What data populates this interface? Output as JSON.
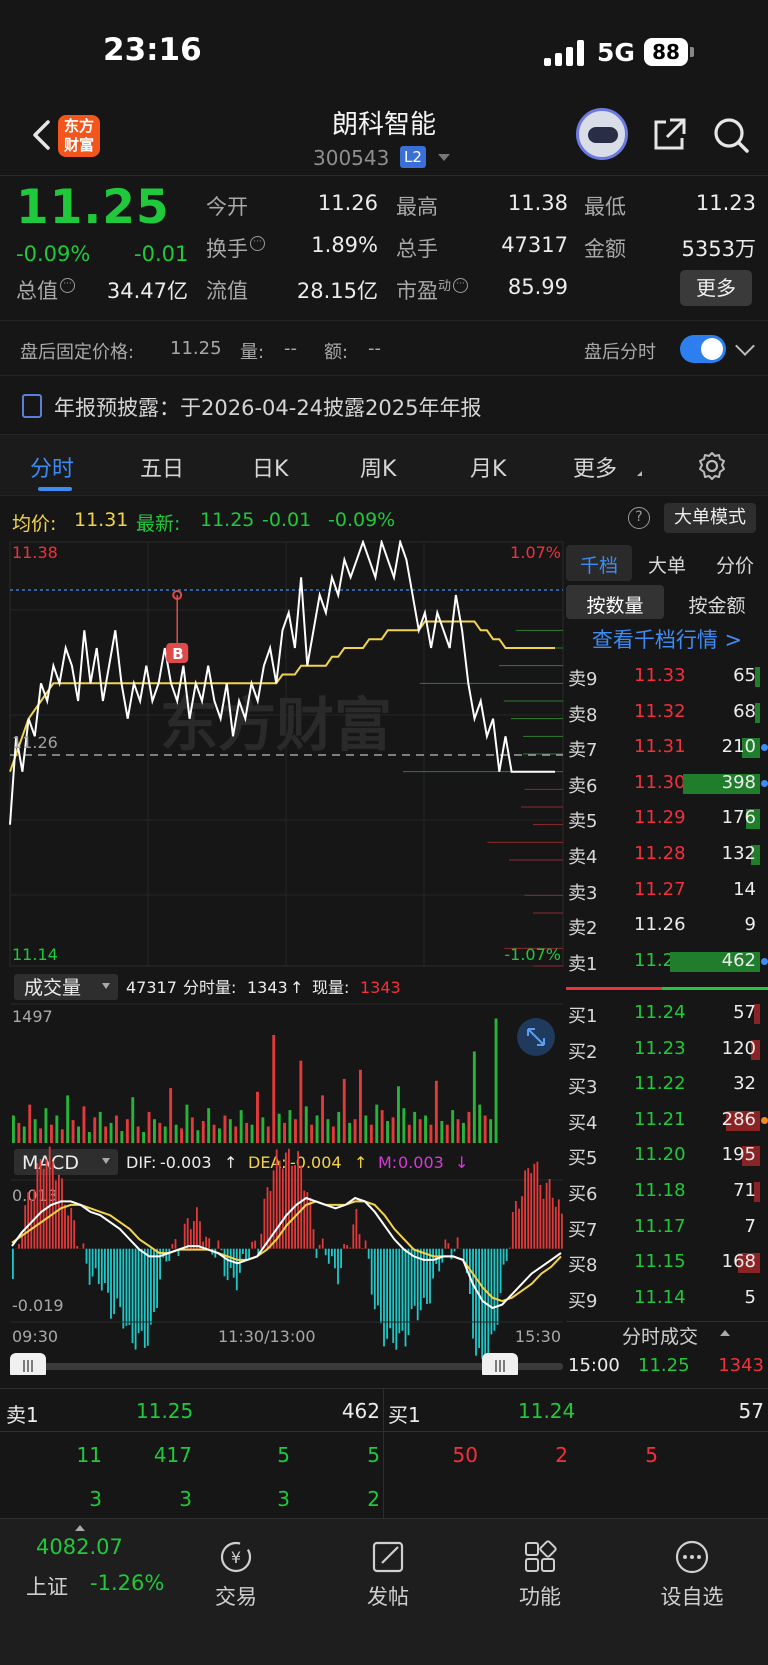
{
  "status_bar": {
    "time": "23:16",
    "network": "5G",
    "battery": "88"
  },
  "header": {
    "logo_text": "东方财富",
    "stock_name": "朗科智能",
    "stock_code": "300543",
    "level_badge": "L2"
  },
  "quote": {
    "price": "11.25",
    "change_pct": "-0.09%",
    "change": "-0.01",
    "open_label": "今开",
    "open": "11.26",
    "high_label": "最高",
    "high": "11.38",
    "low_label": "最低",
    "low": "11.23",
    "turnover_label": "换手",
    "turnover": "1.89%",
    "volume_label": "总手",
    "volume": "47317",
    "amount_label": "金额",
    "amount": "5353万",
    "mktcap_label": "总值",
    "mktcap": "34.47亿",
    "float_label": "流值",
    "float_cap": "28.15亿",
    "pe_label": "市盈",
    "pe_sup": "动",
    "pe": "85.99",
    "more_label": "更多"
  },
  "after_hours": {
    "fixed_price_label": "盘后固定价格:",
    "fixed_price": "11.25",
    "volume_label": "量:",
    "volume": "--",
    "amount_label": "额:",
    "amount": "--",
    "intraday_label": "盘后分时",
    "toggle_on": true
  },
  "notice": {
    "text": "年报预披露：于2026-04-24披露2025年年报"
  },
  "tabs": [
    {
      "label": "分时",
      "active": true
    },
    {
      "label": "五日"
    },
    {
      "label": "日K"
    },
    {
      "label": "周K"
    },
    {
      "label": "月K"
    },
    {
      "label": "更多"
    }
  ],
  "avg_bar": {
    "avg_label": "均价:",
    "avg": "11.31",
    "latest_label": "最新:",
    "latest": "11.25",
    "chg": "-0.01",
    "pct": "-0.09%",
    "big_order_label": "大单模式"
  },
  "chart_data": [
    {
      "type": "line",
      "y_max": "11.38",
      "y_min": "11.14",
      "y_ref": "11.26",
      "pct_max": "1.07%",
      "pct_min": "-1.07%",
      "x_labels": [
        "09:30",
        "11:30/13:00",
        "15:30"
      ],
      "ylim": [
        11.14,
        11.38
      ],
      "series": [
        {
          "values": [
            11.22,
            11.27,
            11.25,
            11.28,
            11.27,
            11.3,
            11.29,
            11.31,
            11.3,
            11.32,
            11.31,
            11.29,
            11.33,
            11.3,
            11.32,
            11.29,
            11.31,
            11.33,
            11.3,
            11.28,
            11.3,
            11.29,
            11.31,
            11.29,
            11.3,
            11.32,
            11.3,
            11.29,
            11.31,
            11.28,
            11.3,
            11.29,
            11.31,
            11.29,
            11.28,
            11.3,
            11.27,
            11.29,
            11.28,
            11.3,
            11.29,
            11.31,
            11.32,
            11.3,
            11.33,
            11.34,
            11.32,
            11.36,
            11.31,
            11.33,
            11.35,
            11.34,
            11.36,
            11.35,
            11.37,
            11.36,
            11.37,
            11.38,
            11.37,
            11.36,
            11.38,
            11.37,
            11.36,
            11.38,
            11.37,
            11.35,
            11.33,
            11.34,
            11.32,
            11.34,
            11.33,
            11.32,
            11.35,
            11.33,
            11.3,
            11.28,
            11.29,
            11.27,
            11.28,
            11.25,
            11.27,
            11.25,
            11.25,
            11.25,
            11.25,
            11.25,
            11.25,
            11.25,
            11.25
          ]
        },
        {
          "values": [
            11.25,
            11.26,
            11.27,
            11.28,
            11.285,
            11.29,
            11.295,
            11.3,
            11.3,
            11.3,
            11.3,
            11.3,
            11.3,
            11.3,
            11.3,
            11.3,
            11.3,
            11.3,
            11.3,
            11.3,
            11.3,
            11.3,
            11.3,
            11.3,
            11.3,
            11.3,
            11.3,
            11.3,
            11.3,
            11.3,
            11.3,
            11.3,
            11.3,
            11.3,
            11.3,
            11.3,
            11.3,
            11.3,
            11.3,
            11.3,
            11.3,
            11.3,
            11.3,
            11.3,
            11.305,
            11.305,
            11.305,
            11.31,
            11.31,
            11.31,
            11.31,
            11.31,
            11.315,
            11.315,
            11.32,
            11.32,
            11.32,
            11.32,
            11.325,
            11.325,
            11.325,
            11.33,
            11.33,
            11.33,
            11.33,
            11.33,
            11.33,
            11.335,
            11.335,
            11.335,
            11.335,
            11.335,
            11.335,
            11.335,
            11.335,
            11.335,
            11.33,
            11.33,
            11.325,
            11.325,
            11.32,
            11.32,
            11.32,
            11.32,
            11.32,
            11.32,
            11.32,
            11.32,
            11.32
          ]
        }
      ],
      "marker": "B"
    },
    {
      "type": "bar",
      "label": "成交量",
      "total": "47317",
      "period_label": "分时量:",
      "period_vol": "1343",
      "now_label": "现量:",
      "now_vol": "1343",
      "y_max": "1497",
      "values": [
        300,
        220,
        180,
        420,
        260,
        160,
        380,
        200,
        300,
        150,
        520,
        250,
        180,
        400,
        120,
        280,
        340,
        180,
        220,
        300,
        130,
        260,
        500,
        180,
        120,
        340,
        260,
        220,
        180,
        600,
        200,
        160,
        420,
        280,
        140,
        240,
        380,
        200,
        160,
        300,
        260,
        180,
        360,
        220,
        200,
        560,
        280,
        180,
        1180,
        320,
        220,
        360,
        260,
        900,
        400,
        200,
        300,
        520,
        260,
        180,
        340,
        700,
        220,
        260,
        800,
        300,
        200,
        420,
        360,
        240,
        280,
        620,
        380,
        200,
        340,
        260,
        300,
        200,
        680,
        240,
        200,
        360,
        260,
        220,
        340,
        1000,
        420,
        300,
        260,
        1360
      ],
      "colors": [
        "g",
        "r",
        "g",
        "r",
        "g",
        "r",
        "g",
        "r",
        "g",
        "r",
        "g",
        "r",
        "g",
        "r",
        "g",
        "r",
        "g",
        "r",
        "g",
        "r",
        "g",
        "r",
        "g",
        "r",
        "g",
        "r",
        "g",
        "r",
        "g",
        "r",
        "g",
        "r",
        "g",
        "r",
        "g",
        "r",
        "g",
        "r",
        "g",
        "r",
        "g",
        "r",
        "g",
        "r",
        "g",
        "r",
        "g",
        "r",
        "r",
        "g",
        "r",
        "g",
        "r",
        "r",
        "g",
        "r",
        "g",
        "r",
        "g",
        "r",
        "g",
        "r",
        "g",
        "r",
        "r",
        "g",
        "r",
        "g",
        "r",
        "g",
        "r",
        "g",
        "g",
        "r",
        "g",
        "r",
        "g",
        "r",
        "r",
        "g",
        "r",
        "g",
        "r",
        "g",
        "r",
        "g",
        "g",
        "r",
        "g",
        "g"
      ]
    },
    {
      "type": "line",
      "label": "MACD",
      "dif_label": "DIF:",
      "dif": "-0.003",
      "dea_label": "DEA:",
      "dea": "-0.004",
      "m_label": "M:",
      "m": "0.003",
      "y_max": "0.013",
      "y_min": "-0.019",
      "series": [
        {
          "values": [
            -0.001,
            0.003,
            0.006,
            0.009,
            0.011,
            0.012,
            0.012,
            0.011,
            0.009,
            0.008,
            0.006,
            0.004,
            0.001,
            -0.002,
            -0.004,
            -0.004,
            -0.003,
            -0.002,
            -0.001,
            -0.001,
            -0.002,
            -0.003,
            -0.005,
            -0.006,
            -0.005,
            -0.004,
            0.0,
            0.004,
            0.008,
            0.011,
            0.013,
            0.012,
            0.011,
            0.01,
            0.011,
            0.013,
            0.012,
            0.009,
            0.005,
            0.001,
            -0.002,
            -0.004,
            -0.005,
            -0.005,
            -0.004,
            -0.004,
            -0.005,
            -0.012,
            -0.017,
            -0.019,
            -0.018,
            -0.015,
            -0.012,
            -0.009,
            -0.007,
            -0.005,
            -0.003
          ]
        },
        {
          "values": [
            0.0,
            0.002,
            0.004,
            0.006,
            0.008,
            0.01,
            0.011,
            0.011,
            0.01,
            0.009,
            0.008,
            0.006,
            0.004,
            0.001,
            -0.001,
            -0.003,
            -0.003,
            -0.002,
            -0.002,
            -0.002,
            -0.002,
            -0.003,
            -0.004,
            -0.005,
            -0.005,
            -0.004,
            -0.002,
            0.001,
            0.005,
            0.008,
            0.011,
            0.012,
            0.011,
            0.011,
            0.011,
            0.012,
            0.012,
            0.011,
            0.008,
            0.004,
            0.001,
            -0.002,
            -0.003,
            -0.004,
            -0.004,
            -0.004,
            -0.005,
            -0.009,
            -0.013,
            -0.016,
            -0.017,
            -0.016,
            -0.014,
            -0.012,
            -0.009,
            -0.007,
            -0.004
          ]
        }
      ]
    }
  ],
  "order_book": {
    "tabs": [
      "千档",
      "大单",
      "分价"
    ],
    "subtabs": [
      "按数量",
      "按金额"
    ],
    "link": "查看千档行情 >",
    "asks": [
      {
        "label": "卖9",
        "price": "11.33",
        "vol": "65",
        "bar": 0.06,
        "pc": "r"
      },
      {
        "label": "卖8",
        "price": "11.32",
        "vol": "68",
        "bar": 0.06,
        "pc": "r"
      },
      {
        "label": "卖7",
        "price": "11.31",
        "vol": "210",
        "bar": 0.2,
        "pc": "r",
        "dot": "#3d8cf5"
      },
      {
        "label": "卖6",
        "price": "11.30",
        "vol": "398",
        "bar": 0.86,
        "pc": "r",
        "dot": "#3d8cf5"
      },
      {
        "label": "卖5",
        "price": "11.29",
        "vol": "176",
        "bar": 0.16,
        "pc": "r"
      },
      {
        "label": "卖4",
        "price": "11.28",
        "vol": "132",
        "bar": 0.1,
        "pc": "r"
      },
      {
        "label": "卖3",
        "price": "11.27",
        "vol": "14",
        "bar": 0,
        "pc": "r"
      },
      {
        "label": "卖2",
        "price": "11.26",
        "vol": "9",
        "bar": 0,
        "pc": "w"
      },
      {
        "label": "卖1",
        "price": "11.25",
        "vol": "462",
        "bar": 1.0,
        "pc": "g",
        "dot": "#3d8cf5"
      }
    ],
    "bids": [
      {
        "label": "买1",
        "price": "11.24",
        "vol": "57",
        "bar": 0.07,
        "pc": "g"
      },
      {
        "label": "买2",
        "price": "11.23",
        "vol": "120",
        "bar": 0.1,
        "pc": "g"
      },
      {
        "label": "买3",
        "price": "11.22",
        "vol": "32",
        "bar": 0,
        "pc": "g"
      },
      {
        "label": "买4",
        "price": "11.21",
        "vol": "286",
        "bar": 0.38,
        "pc": "g",
        "dot": "#f08a22"
      },
      {
        "label": "买5",
        "price": "11.20",
        "vol": "195",
        "bar": 0.2,
        "pc": "g"
      },
      {
        "label": "买6",
        "price": "11.18",
        "vol": "71",
        "bar": 0.07,
        "pc": "g"
      },
      {
        "label": "买7",
        "price": "11.17",
        "vol": "7",
        "bar": 0,
        "pc": "g"
      },
      {
        "label": "买8",
        "price": "11.15",
        "vol": "168",
        "bar": 0.24,
        "pc": "g"
      },
      {
        "label": "买9",
        "price": "11.14",
        "vol": "5",
        "bar": 0,
        "pc": "g"
      }
    ],
    "ticks_label": "分时成交",
    "last_tick": {
      "time": "15:00",
      "price": "11.25",
      "vol": "1343"
    }
  },
  "l2_table": {
    "ask1_label": "卖1",
    "ask1_price": "11.25",
    "ask1_vol": "462",
    "bid1_label": "买1",
    "bid1_price": "11.24",
    "bid1_vol": "57",
    "ask_queue": [
      "11",
      "417",
      "5",
      "5",
      "3",
      "3",
      "3",
      "2"
    ],
    "bid_queue": [
      "50",
      "2",
      "5"
    ]
  },
  "bottom_nav": {
    "index_value": "4082.07",
    "index_name": "上证",
    "index_pct": "-1.26%",
    "items": [
      "交易",
      "发帖",
      "功能",
      "设自选"
    ]
  },
  "watermark": "东方财富"
}
